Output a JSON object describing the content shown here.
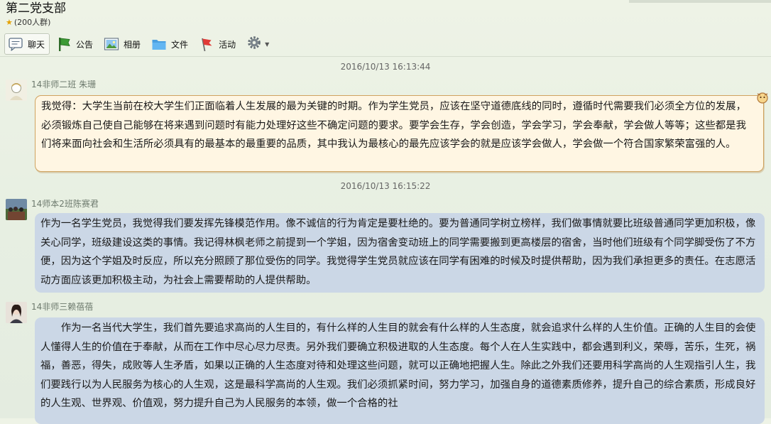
{
  "group": {
    "title": "第二党支部",
    "member_count": "(200人群)"
  },
  "toolbar": {
    "tabs": [
      {
        "label": "聊天",
        "icon": "chat-icon",
        "active": true
      },
      {
        "label": "公告",
        "icon": "announcement-flag-icon"
      },
      {
        "label": "相册",
        "icon": "album-photo-icon"
      },
      {
        "label": "文件",
        "icon": "folder-icon"
      },
      {
        "label": "活动",
        "icon": "red-flag-icon"
      }
    ],
    "settings_icon": "gear-icon"
  },
  "messages": [
    {
      "timestamp": "2016/10/13 16:13:44",
      "sender": "14非师二班  朱珊",
      "bubble_style": "yellow",
      "text": "我觉得：大学生当前在校大学生们正面临着人生发展的最为关键的时期。作为学生党员，应该在坚守道德底线的同时，遵循时代需要我们必须全方位的发展，必须锻炼自己使自己能够在将来遇到问题时有能力处理好这些不确定问题的要求。要学会生存，学会创造，学会学习，学会奉献，学会做人等等；这些都是我们将来面向社会和生活所必须具有的最基本的最重要的品质，其中我认为最核心的最先应该学会的就是应该学会做人，学会做一个符合国家繁荣富强的人。"
    },
    {
      "timestamp": "2016/10/13 16:15:22",
      "sender": "14师本2班陈赛君",
      "bubble_style": "blue",
      "text": "作为一名学生党员，我觉得我们要发挥先锋模范作用。像不诚信的行为肯定是要杜绝的。要为普通同学树立榜样，我们做事情就要比班级普通同学更加积极，像关心同学，班级建设这类的事情。我记得林枫老师之前提到一个学姐，因为宿舍变动班上的同学需要搬到更高楼层的宿舍，当时他们班级有个同学脚受伤了不方便，因为这个学姐及时反应，所以充分照顾了那位受伤的同学。我觉得学生党员就应该在同学有困难的时候及时提供帮助，因为我们承担更多的责任。在志愿活动方面应该更加积极主动，为社会上需要帮助的人提供帮助。"
    },
    {
      "sender": "14非师三赖蓓蓓",
      "bubble_style": "blue",
      "text": "作为一名当代大学生，我们首先要追求高尚的人生目的，有什么样的人生目的就会有什么样的人生态度，就会追求什么样的人生价值。正确的人生目的会使人懂得人生的价值在于奉献，从而在工作中尽心尽力尽责。另外我们要确立积极进取的人生态度。每个人在人生实践中，都会遇到利义，荣辱，苦乐，生死，祸福，善恶，得失，成败等人生矛盾，如果以正确的人生态度对待和处理这些问题，就可以正确地把握人生。除此之外我们还要用科学高尚的人生观指引人生，我们要践行以为人民服务为核心的人生观，这是最科学高尚的人生观。我们必须抓紧时间，努力学习，加强自身的道德素质修养，提升自己的综合素质，形成良好的人生观、世界观、价值观，努力提升自己为人民服务的本领，做一个合格的社"
    }
  ]
}
